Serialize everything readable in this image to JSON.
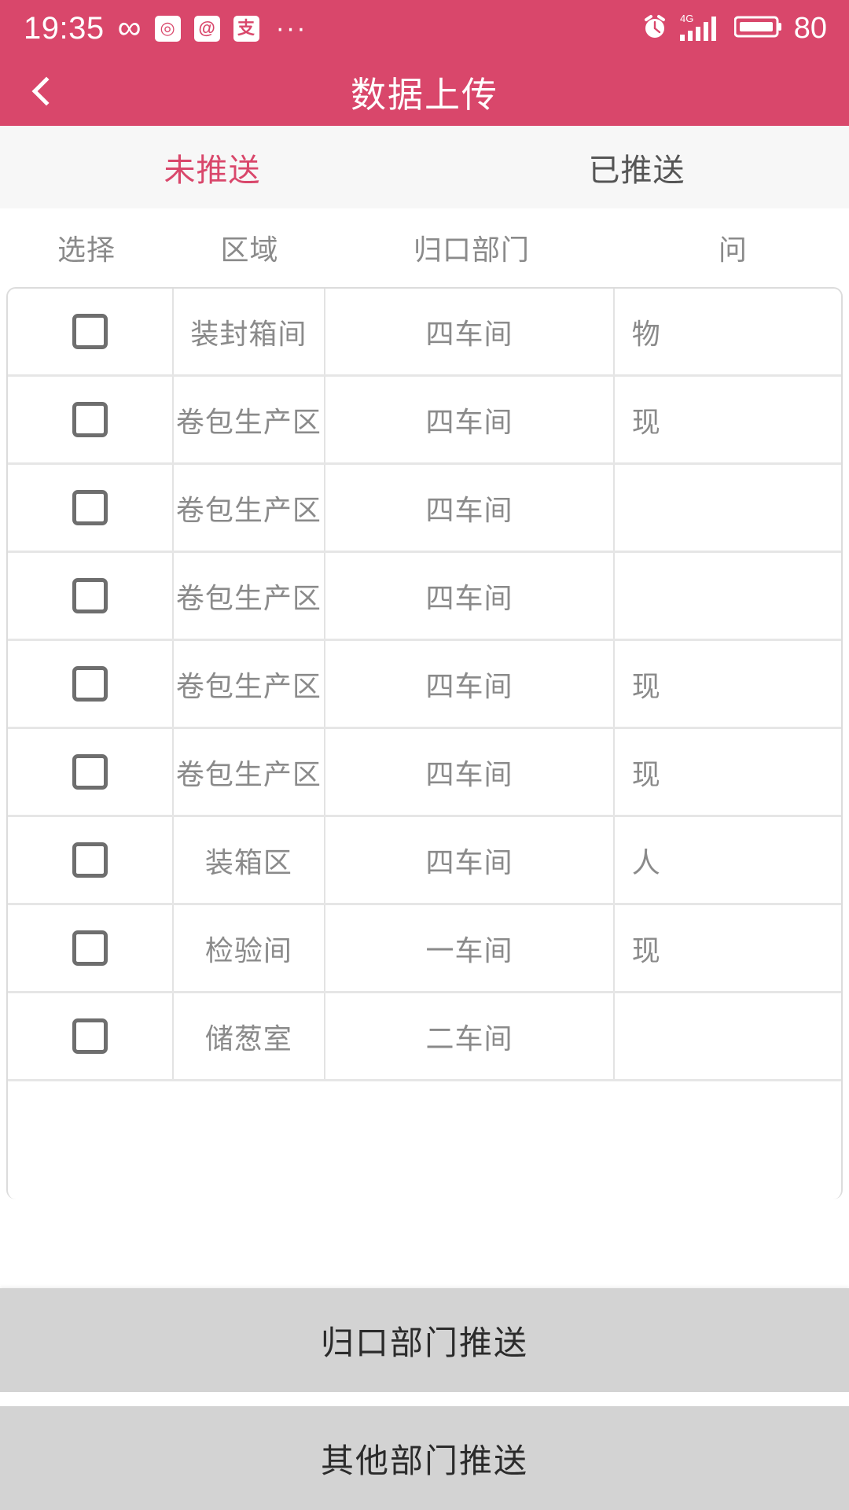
{
  "statusbar": {
    "time": "19:35",
    "infinity_icon": "infinity-icon",
    "app_icons": [
      "app-icon-meitu",
      "app-icon-weibo",
      "app-icon-alipay"
    ],
    "overflow": "···",
    "alarm_icon": "alarm-clock-icon",
    "network": "4G",
    "signal_icon": "signal-bars-icon",
    "battery_icon": "battery-icon",
    "battery_level": "80"
  },
  "titlebar": {
    "back_icon": "back-chevron-icon",
    "title": "数据上传"
  },
  "tabs": [
    {
      "label": "未推送",
      "active": true
    },
    {
      "label": "已推送",
      "active": false
    }
  ],
  "table": {
    "headers": [
      "选择",
      "区域",
      "归口部门",
      "问"
    ],
    "rows": [
      {
        "checked": false,
        "area": "装封箱间",
        "dept": "四车间",
        "type": "物"
      },
      {
        "checked": false,
        "area": "卷包生产区",
        "dept": "四车间",
        "type": "现"
      },
      {
        "checked": false,
        "area": "卷包生产区",
        "dept": "四车间",
        "type": ""
      },
      {
        "checked": false,
        "area": "卷包生产区",
        "dept": "四车间",
        "type": ""
      },
      {
        "checked": false,
        "area": "卷包生产区",
        "dept": "四车间",
        "type": "现"
      },
      {
        "checked": false,
        "area": "卷包生产区",
        "dept": "四车间",
        "type": "现"
      },
      {
        "checked": false,
        "area": "装箱区",
        "dept": "四车间",
        "type": "人"
      },
      {
        "checked": false,
        "area": "检验间",
        "dept": "一车间",
        "type": "现"
      },
      {
        "checked": false,
        "area": "储葱室",
        "dept": "二车间",
        "type": ""
      }
    ]
  },
  "bottom_buttons": [
    {
      "label": "归口部门推送"
    },
    {
      "label": "其他部门推送"
    }
  ],
  "colors": {
    "brand_pink": "#D9476B",
    "tab_bg": "#F7F7F7",
    "button_bg": "#D3D3D3",
    "text_gray": "#8A8A8A"
  }
}
